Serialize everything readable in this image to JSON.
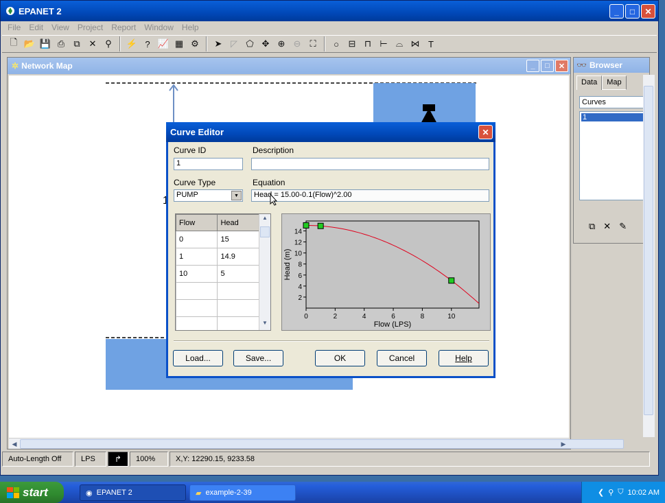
{
  "app": {
    "title": "EPANET 2"
  },
  "menu": [
    "File",
    "Edit",
    "View",
    "Project",
    "Report",
    "Window",
    "Help"
  ],
  "network_map": {
    "title": "Network Map",
    "node_label_fragment": "1"
  },
  "browser": {
    "title": "Browser",
    "tabs": [
      "Data",
      "Map"
    ],
    "category": "Curves",
    "selected_item": "1"
  },
  "status": {
    "auto_length": "Auto-Length Off",
    "units": "LPS",
    "zoom": "100%",
    "coords": "X,Y: 12290.15, 9233.58"
  },
  "dialog": {
    "title": "Curve Editor",
    "curve_id_label": "Curve ID",
    "curve_id_value": "1",
    "description_label": "Description",
    "description_value": "",
    "curve_type_label": "Curve Type",
    "curve_type_value": "PUMP",
    "equation_label": "Equation",
    "equation_value": "Head = 15.00-0.1(Flow)^2.00",
    "table": {
      "headers": [
        "Flow",
        "Head"
      ],
      "rows": [
        [
          "0",
          "15"
        ],
        [
          "1",
          "14.9"
        ],
        [
          "10",
          "5"
        ],
        [
          "",
          ""
        ],
        [
          "",
          ""
        ],
        [
          "",
          ""
        ]
      ]
    },
    "buttons": {
      "load": "Load...",
      "save": "Save...",
      "ok": "OK",
      "cancel": "Cancel",
      "help": "Help"
    }
  },
  "chart_data": {
    "type": "line",
    "xlabel": "Flow (LPS)",
    "ylabel": "Head (m)",
    "xlim": [
      0,
      11.9
    ],
    "ylim": [
      0,
      15.8
    ],
    "xticks": [
      0,
      2,
      4,
      6,
      8,
      10
    ],
    "yticks": [
      2,
      4,
      6,
      8,
      10,
      12,
      14
    ],
    "curve_color": "#e0001c",
    "points_color": "#22cc22",
    "points": [
      {
        "x": 0,
        "y": 15
      },
      {
        "x": 1,
        "y": 14.9
      },
      {
        "x": 10,
        "y": 5
      }
    ],
    "equation": {
      "a": 15.0,
      "b": 0.1,
      "c": 2.0
    }
  },
  "taskbar": {
    "start_label": "start",
    "tasks": [
      "EPANET 2",
      "example-2-39"
    ],
    "clock": "10:02 AM"
  }
}
